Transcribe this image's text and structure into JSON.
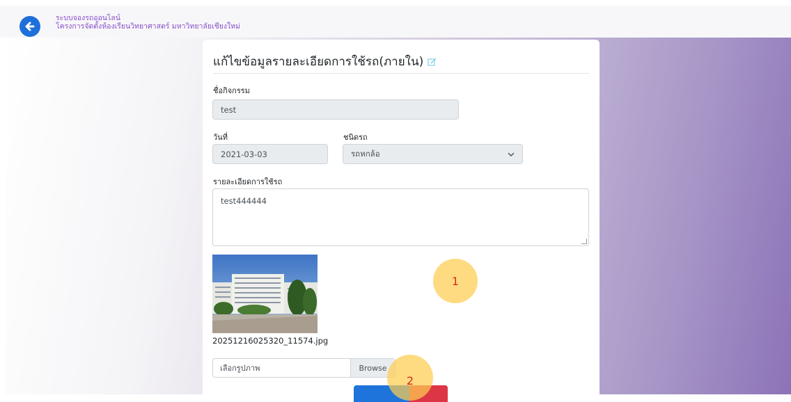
{
  "header": {
    "brand_line1": "ระบบจองรถออนไลน์",
    "brand_line2": "โครงการจัดตั้งห้องเรียนวิทยาศาสตร์ มหาวิทยาลัยเชียงใหม่",
    "back_icon": "arrow-left-circle-icon"
  },
  "form": {
    "title": "แก้ไขข้อมูลรายละเอียดการใช้รถ(ภายใน)",
    "title_icon": "edit-icon",
    "activity_label": "ชื่อกิจกรรม",
    "activity_value": "test",
    "date_label": "วันที่",
    "date_value": "2021-03-03",
    "vehicle_type_label": "ชนิดรถ",
    "vehicle_type_value": "รถหกล้อ",
    "details_label": "รายละเอียดการใช้รถ",
    "details_value": "test444444",
    "image_filename": "20251216025320_11574.jpg",
    "file_placeholder": "เลือกรูปภาพ",
    "browse_label": "Browse"
  },
  "annotations": {
    "marker1": "1",
    "marker2": "2"
  },
  "colors": {
    "primary": "#1f74db",
    "danger": "#dc3545",
    "brand_text": "#8a4fc8",
    "marker": "#fdcd50"
  }
}
